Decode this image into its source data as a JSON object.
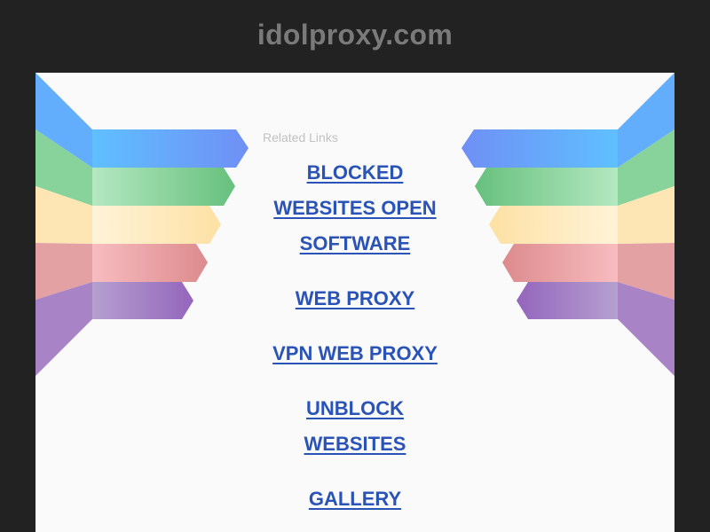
{
  "header": {
    "domain": "idolproxy.com"
  },
  "content": {
    "related_heading": "Related Links",
    "links": [
      {
        "label": "BLOCKED WEBSITES OPEN SOFTWARE"
      },
      {
        "label": "WEB PROXY"
      },
      {
        "label": "VPN WEB PROXY"
      },
      {
        "label": "UNBLOCK WEBSITES"
      },
      {
        "label": "GALLERY"
      }
    ]
  },
  "colors": {
    "background": "#222222",
    "panel": "#fafafa",
    "title": "#7a7a7a",
    "link": "#2a53b8",
    "related_heading": "#c2c2c2",
    "ribbon_blue": "#5aa9f5",
    "ribbon_green": "#77c78a",
    "ribbon_yellow": "#fde0a0",
    "ribbon_red": "#e59ea0",
    "ribbon_purple": "#a27cc5"
  }
}
